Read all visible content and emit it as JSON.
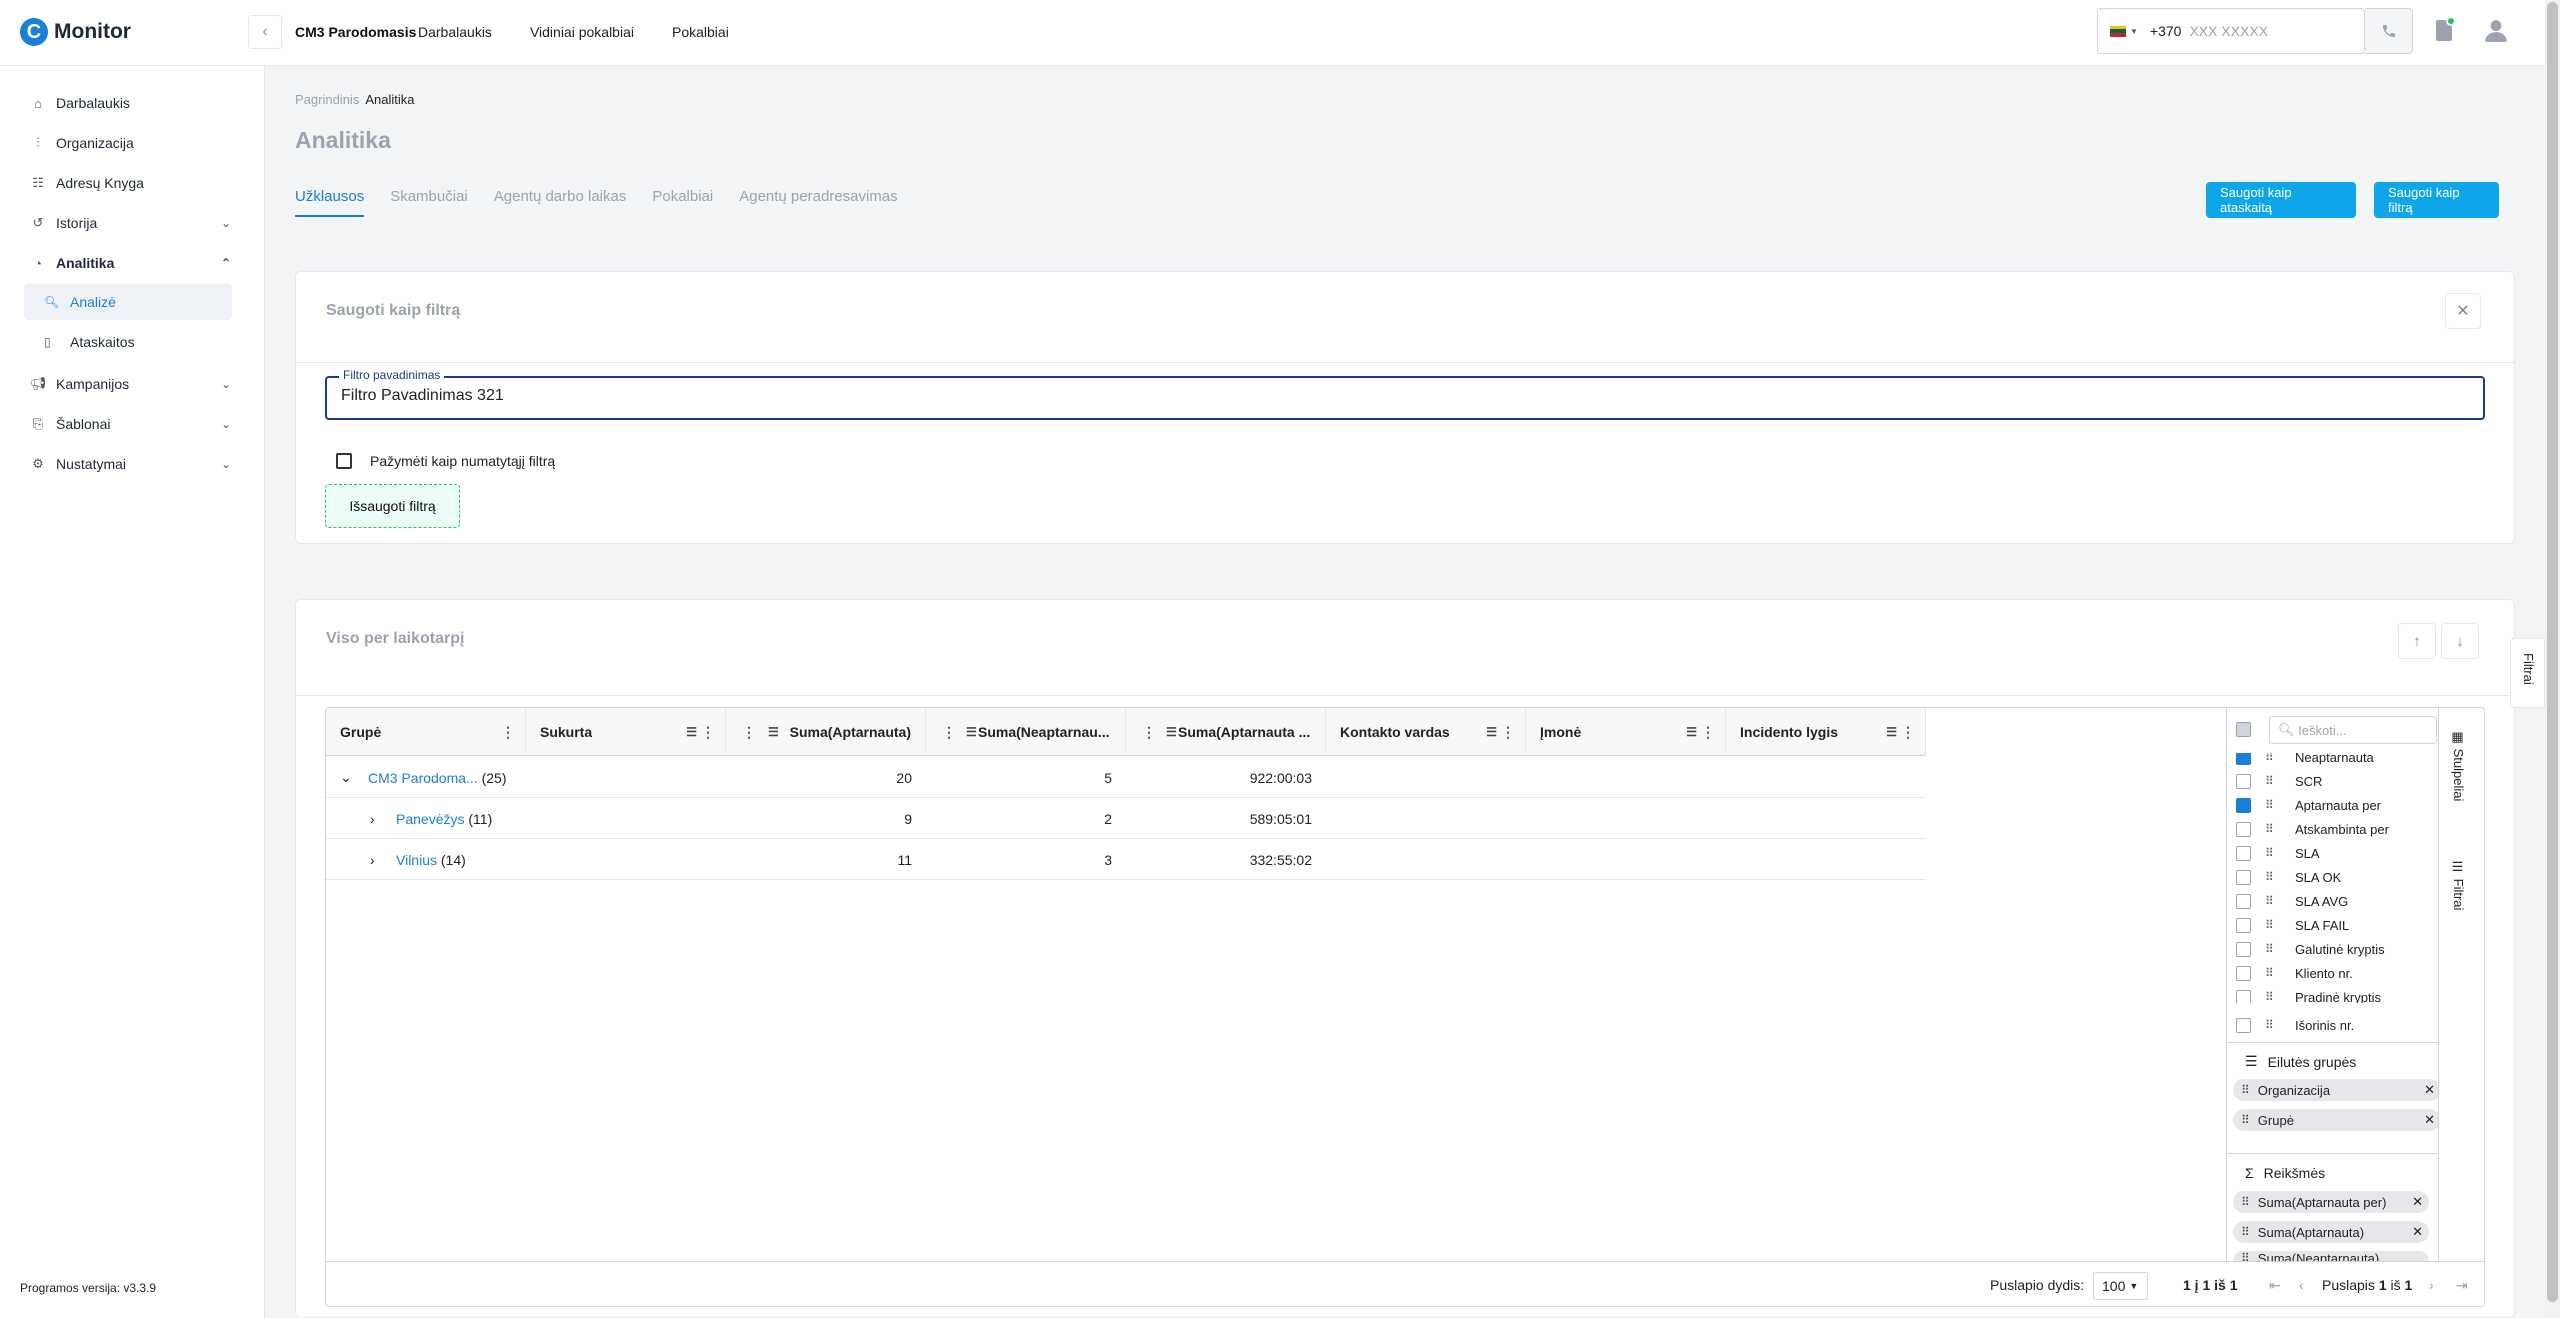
{
  "app": {
    "logo_letter": "C",
    "name": "Monitor",
    "tenant": "CM3 Parodomasis"
  },
  "topnav": [
    "Darbalaukis",
    "Vidiniai pokalbiai",
    "Pokalbiai"
  ],
  "phone": {
    "dial_code": "+370",
    "placeholder": "XXX XXXXX"
  },
  "sidebar": {
    "items": [
      {
        "label": "Darbalaukis",
        "icon": "home-icon"
      },
      {
        "label": "Organizacija",
        "icon": "org-icon"
      },
      {
        "label": "Adresų Knyga",
        "icon": "address-book-icon"
      },
      {
        "label": "Istorija",
        "icon": "history-icon"
      },
      {
        "label": "Analitika",
        "icon": "analytics-icon"
      },
      {
        "label": "Kampanijos",
        "icon": "megaphone-icon"
      },
      {
        "label": "Šablonai",
        "icon": "template-icon"
      },
      {
        "label": "Nustatymai",
        "icon": "gear-icon"
      }
    ],
    "sub": [
      {
        "label": "Analizė"
      },
      {
        "label": "Ataskaitos"
      }
    ],
    "version": "Programos versija: v3.3.9"
  },
  "breadcrumb": {
    "root": "Pagrindinis",
    "current": "Analitika"
  },
  "page_title": "Analitika",
  "tabs": [
    "Užklausos",
    "Skambučiai",
    "Agentų darbo laikas",
    "Pokalbiai",
    "Agentų peradresavimas"
  ],
  "actions": {
    "save_report": "Saugoti kaip ataskaitą",
    "save_filter": "Saugoti kaip filtrą"
  },
  "filter_card": {
    "title": "Saugoti kaip filtrą",
    "field_label": "Filtro pavadinimas",
    "field_value": "Filtro Pavadinimas 321",
    "default_checkbox": "Pažymėti kaip numatytąjį filtrą",
    "submit": "Išsaugoti filtrą"
  },
  "grid_card": {
    "title": "Viso per laikotarpį"
  },
  "grid": {
    "columns": [
      "Grupė",
      "Sukurta",
      "Suma(Aptarnauta)",
      "Suma(Neaptarnau...",
      "Suma(Aptarnauta ...",
      "Kontakto vardas",
      "Įmonė",
      "Incidento lygis"
    ],
    "rows": [
      {
        "name": "CM3 Parodoma...",
        "count": "(25)",
        "a": "20",
        "n": "5",
        "t": "922:00:03"
      },
      {
        "name": "Panevėžys",
        "count": "(11)",
        "a": "9",
        "n": "2",
        "t": "589:05:01"
      },
      {
        "name": "Vilnius",
        "count": "(14)",
        "a": "11",
        "n": "3",
        "t": "332:55:02"
      }
    ],
    "footer": {
      "page_size_label": "Puslapio dydis:",
      "page_size": "100",
      "range": "1 į 1 iš 1",
      "page_word": "Puslapis",
      "page": "1",
      "of_word": "iš",
      "total_pages": "1"
    }
  },
  "columns_panel": {
    "search_placeholder": "Ieškoti...",
    "items": [
      {
        "label": "Neaptarnauta",
        "checked": true
      },
      {
        "label": "SCR",
        "checked": false
      },
      {
        "label": "Aptarnauta per",
        "checked": true
      },
      {
        "label": "Atskambinta per",
        "checked": false
      },
      {
        "label": "SLA",
        "checked": false
      },
      {
        "label": "SLA OK",
        "checked": false
      },
      {
        "label": "SLA AVG",
        "checked": false
      },
      {
        "label": "SLA FAIL",
        "checked": false
      },
      {
        "label": "Galutinė kryptis",
        "checked": false
      },
      {
        "label": "Kliento nr.",
        "checked": false
      },
      {
        "label": "Pradinė kryptis",
        "checked": false
      },
      {
        "label": "Išorinis nr.",
        "checked": false
      }
    ],
    "row_groups_title": "Eilutės grupės",
    "row_groups": [
      "Organizacija",
      "Grupė"
    ],
    "values_title": "Reikšmės",
    "values": [
      "Suma(Aptarnauta per)",
      "Suma(Aptarnauta)",
      "Suma(Neaptarnauta)"
    ],
    "tab_columns": "Stulpeliai",
    "tab_filters": "Filtrai"
  },
  "side_filter_tab": "Filtrai",
  "colors": {
    "accent": "#1a7fd6",
    "button": "#0ea5e9",
    "success": "#22c55e"
  }
}
